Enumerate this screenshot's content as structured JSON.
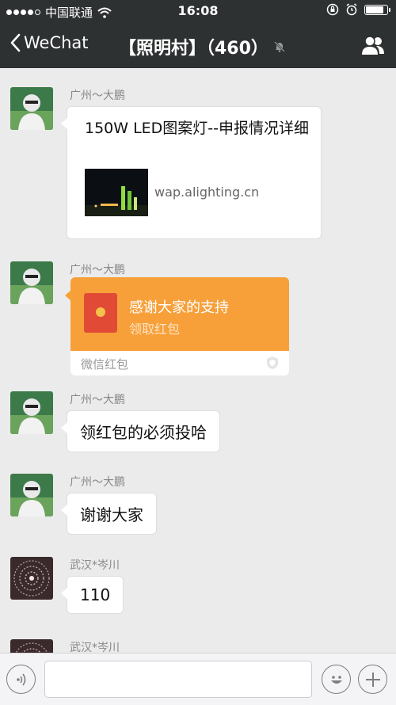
{
  "status_bar": {
    "carrier": "中国联通",
    "time": "16:08",
    "signal_bars_filled": 4,
    "battery_level": 0.85
  },
  "nav": {
    "back_label": "WeChat",
    "title": "【照明村】（460）",
    "muted_icon": "bell-off-icon",
    "members_icon": "group-icon"
  },
  "messages": [
    {
      "sender": "广州～大鹏",
      "type": "link",
      "title": "150W LED图案灯--申报情况详细",
      "domain": "wap.alighting.cn"
    },
    {
      "sender": "广州～大鹏",
      "type": "red_packet",
      "title": "感谢大家的支持",
      "action": "领取红包",
      "brand": "微信红包"
    },
    {
      "sender": "广州～大鹏",
      "type": "text",
      "text": "领红包的必须投哈"
    },
    {
      "sender": "广州～大鹏",
      "type": "text",
      "text": "谢谢大家"
    },
    {
      "sender": "武汉*岑川",
      "type": "text",
      "text": "110"
    },
    {
      "sender": "武汉*岑川",
      "type": "partial"
    }
  ],
  "input_bar": {
    "voice_icon": "voice-icon",
    "emoji_icon": "emoji-icon",
    "plus_icon": "plus-icon",
    "text_value": ""
  },
  "colors": {
    "header_bg": "#2e3132",
    "chat_bg": "#ebebeb",
    "red_packet": "#f7a03a"
  }
}
